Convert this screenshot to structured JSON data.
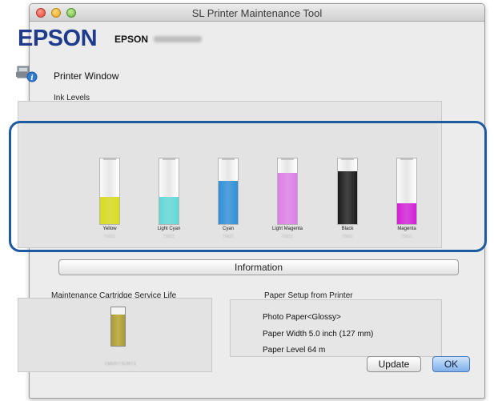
{
  "window": {
    "title": "SL Printer Maintenance Tool"
  },
  "header": {
    "logo": "EPSON",
    "model_prefix": "EPSON",
    "model_suffix_blurred": "SL-D700"
  },
  "printer_window": {
    "label": "Printer Window",
    "icon": "printer-info-icon"
  },
  "ink_levels": {
    "label": "Ink Levels",
    "inks": [
      {
        "name": "Yellow",
        "color": "#d8dc1a",
        "level": 0.42
      },
      {
        "name": "Light Cyan",
        "color": "#5fd9d6",
        "level": 0.42
      },
      {
        "name": "Cyan",
        "color": "#2e8fd8",
        "level": 0.66
      },
      {
        "name": "Light Magenta",
        "color": "#dd7ee8",
        "level": 0.78
      },
      {
        "name": "Black",
        "color": "#1b1b1b",
        "level": 0.8
      },
      {
        "name": "Magenta",
        "color": "#d21fd6",
        "level": 0.32
      }
    ]
  },
  "information_button": {
    "label": "Information"
  },
  "maintenance": {
    "label": "Maintenance Cartridge Service Life",
    "level": 0.82,
    "fill_color": "#b5a743"
  },
  "paper": {
    "label": "Paper Setup from Printer",
    "type": "Photo Paper<Glossy>",
    "width": "Paper Width 5.0 inch (127 mm)",
    "level": "Paper Level 64 m"
  },
  "buttons": {
    "update": "Update",
    "ok": "OK"
  },
  "colors": {
    "highlight": "#1e5a9f",
    "brand": "#1e3b8c"
  }
}
